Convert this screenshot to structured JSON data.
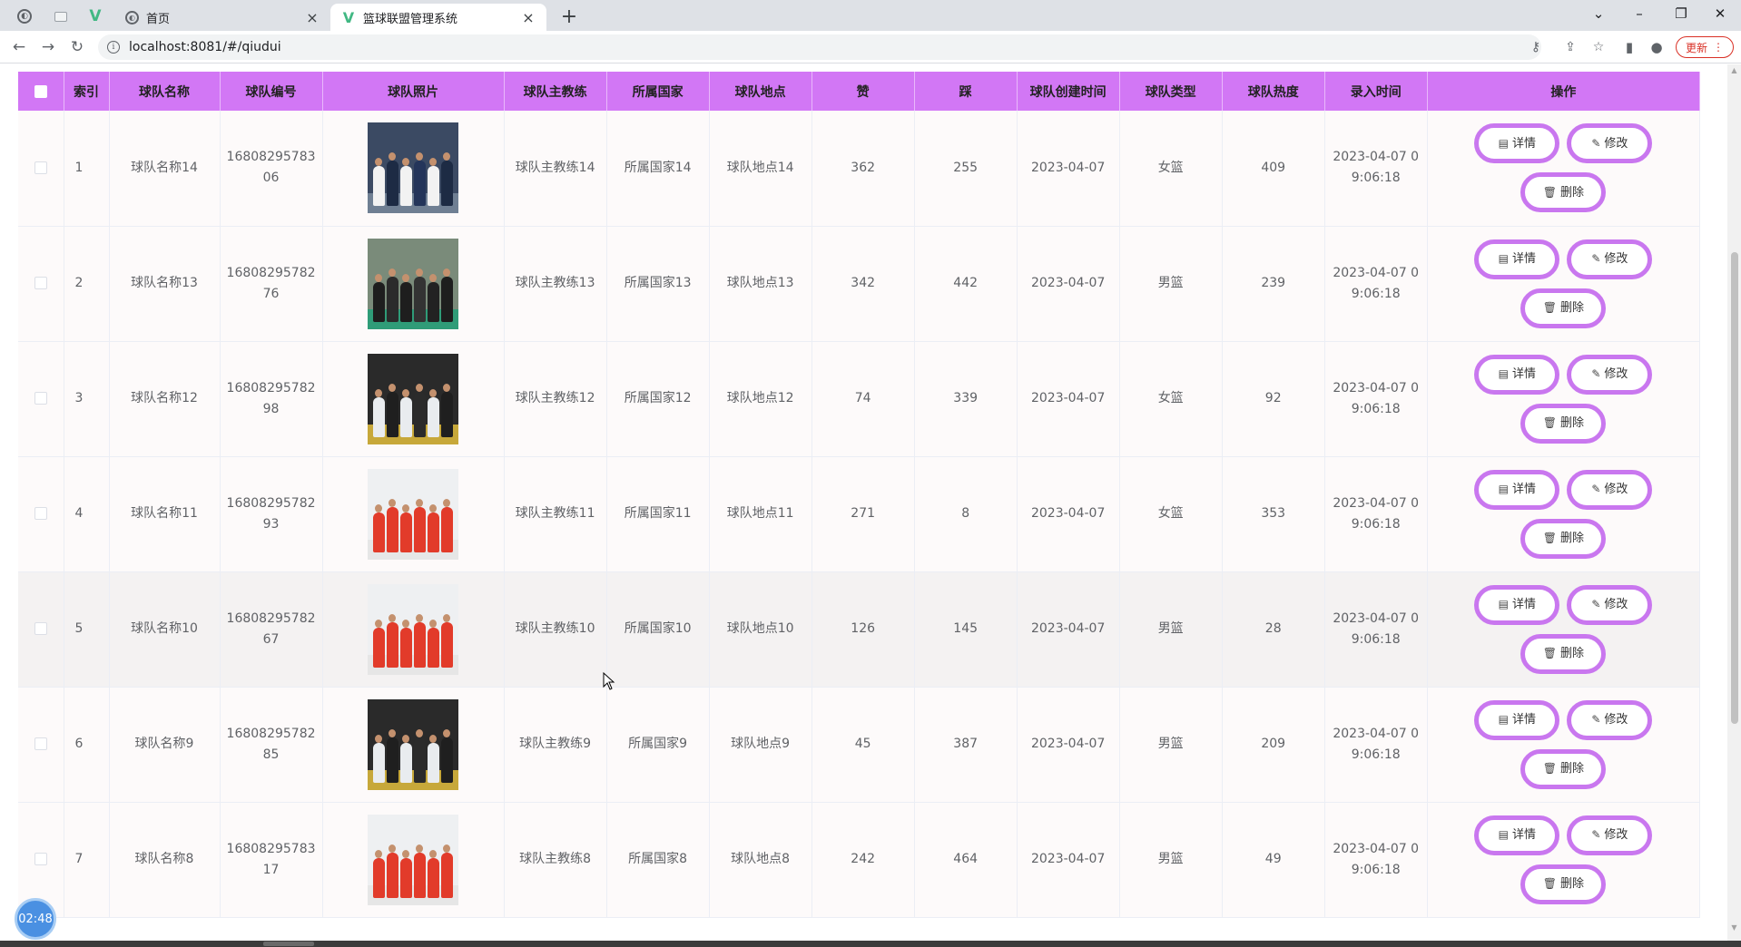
{
  "browser": {
    "tabs": [
      {
        "title": "首页",
        "active": false,
        "icon": "globe-icon"
      },
      {
        "title": "篮球联盟管理系统",
        "active": true,
        "icon": "vue-logo-icon"
      }
    ],
    "url": "localhost:8081/#/qiudui",
    "update_label": "更新"
  },
  "table": {
    "header_color": "#d277f5",
    "button_border_color": "#c977ef",
    "columns": [
      "索引",
      "球队名称",
      "球队编号",
      "球队照片",
      "球队主教练",
      "所属国家",
      "球队地点",
      "赞",
      "踩",
      "球队创建时间",
      "球队类型",
      "球队热度",
      "录入时间",
      "操作"
    ],
    "actions": {
      "detail": "详情",
      "edit": "修改",
      "delete": "删除"
    },
    "rows": [
      {
        "index": "1",
        "name": "球队名称14",
        "code": "16808295783 06",
        "photo": "team-photo-huddle",
        "coach": "球队主教练14",
        "country": "所属国家14",
        "location": "球队地点14",
        "likes": "362",
        "dislikes": "255",
        "created": "2023-04-07",
        "type": "女篮",
        "heat": "409",
        "entry": "2023-04-07 0 9:06:18"
      },
      {
        "index": "2",
        "name": "球队名称13",
        "code": "16808295782 76",
        "photo": "team-photo-court",
        "coach": "球队主教练13",
        "country": "所属国家13",
        "location": "球队地点13",
        "likes": "342",
        "dislikes": "442",
        "created": "2023-04-07",
        "type": "男篮",
        "heat": "239",
        "entry": "2023-04-07 0 9:06:18"
      },
      {
        "index": "3",
        "name": "球队名称12",
        "code": "16808295782 98",
        "photo": "team-photo-celebration",
        "coach": "球队主教练12",
        "country": "所属国家12",
        "location": "球队地点12",
        "likes": "74",
        "dislikes": "339",
        "created": "2023-04-07",
        "type": "女篮",
        "heat": "92",
        "entry": "2023-04-07 0 9:06:18"
      },
      {
        "index": "4",
        "name": "球队名称11",
        "code": "16808295782 93",
        "photo": "team-photo-red-jerseys",
        "coach": "球队主教练11",
        "country": "所属国家11",
        "location": "球队地点11",
        "likes": "271",
        "dislikes": "8",
        "created": "2023-04-07",
        "type": "女篮",
        "heat": "353",
        "entry": "2023-04-07 0 9:06:18"
      },
      {
        "index": "5",
        "name": "球队名称10",
        "code": "16808295782 67",
        "photo": "team-photo-red-jerseys",
        "coach": "球队主教练10",
        "country": "所属国家10",
        "location": "球队地点10",
        "likes": "126",
        "dislikes": "145",
        "created": "2023-04-07",
        "type": "男篮",
        "heat": "28",
        "entry": "2023-04-07 0 9:06:18"
      },
      {
        "index": "6",
        "name": "球队名称9",
        "code": "16808295782 85",
        "photo": "team-photo-celebration",
        "coach": "球队主教练9",
        "country": "所属国家9",
        "location": "球队地点9",
        "likes": "45",
        "dislikes": "387",
        "created": "2023-04-07",
        "type": "男篮",
        "heat": "209",
        "entry": "2023-04-07 0 9:06:18"
      },
      {
        "index": "7",
        "name": "球队名称8",
        "code": "16808295783 17",
        "photo": "team-photo-red-jerseys",
        "coach": "球队主教练8",
        "country": "所属国家8",
        "location": "球队地点8",
        "likes": "242",
        "dislikes": "464",
        "created": "2023-04-07",
        "type": "男篮",
        "heat": "49",
        "entry": "2023-04-07 0 9:06:18"
      }
    ]
  },
  "timer": "02:48"
}
